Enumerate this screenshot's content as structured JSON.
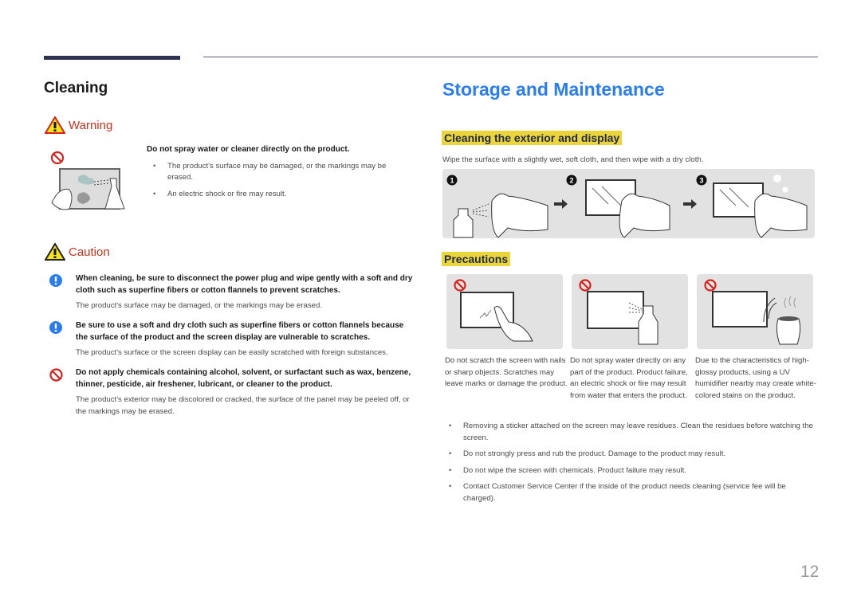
{
  "left": {
    "heading": "Cleaning",
    "warning": {
      "label": "Warning",
      "title": "Do not spray water or cleaner directly on the product.",
      "bullets": [
        "The product's surface may be damaged, or the markings may be erased.",
        "An electric shock or fire may result."
      ]
    },
    "caution": {
      "label": "Caution",
      "items": [
        {
          "icon": "info-icon",
          "title": "When cleaning, be sure to disconnect the power plug and wipe gently with a soft and dry cloth such as superfine fibers or cotton flannels to prevent scratches.",
          "detail": "The product's surface may be damaged, or the markings may be erased."
        },
        {
          "icon": "info-icon",
          "title": "Be sure to use a soft and dry cloth such as superfine fibers or cotton flannels because the surface of the product and the screen display are vulnerable to scratches.",
          "detail": "The product's surface or the screen display can be easily scratched with foreign substances."
        },
        {
          "icon": "prohibited-icon",
          "title": "Do not apply chemicals containing alcohol, solvent, or surfactant such as wax, benzene, thinner, pesticide, air freshener, lubricant, or cleaner to the product.",
          "detail": "The product's exterior may be discolored or cracked, the surface of the panel may be peeled off, or the markings may be erased."
        }
      ]
    }
  },
  "right": {
    "heading": "Storage and Maintenance",
    "exterior": {
      "heading": "Cleaning the exterior and display",
      "text": "Wipe the surface with a slightly wet, soft cloth, and then wipe with a dry cloth.",
      "steps": [
        "1",
        "2",
        "3"
      ]
    },
    "precautions": {
      "heading": "Precautions",
      "captions": [
        "Do not scratch the screen with nails or sharp objects. Scratches may leave marks or damage the product.",
        "Do not spray water directly on any part of the product. Product failure, an electric shock or fire may result from water that enters the product.",
        "Due to the characteristics of high-glossy products, using a UV humidifier nearby may create white-colored stains on the product."
      ],
      "bullets": [
        "Removing a sticker attached on the screen may leave residues. Clean the residues before watching the screen.",
        "Do not strongly press and rub the product. Damage to the product may result.",
        "Do not wipe the screen with chemicals. Product failure may result.",
        "Contact Customer Service Center if the inside of the product needs cleaning (service fee will be charged)."
      ]
    }
  },
  "page_number": "12",
  "colors": {
    "accent_blue": "#2a7df0",
    "highlight_yellow": "#ecd53b",
    "alert_red": "#c8321c",
    "bar_navy": "#2b3350"
  }
}
